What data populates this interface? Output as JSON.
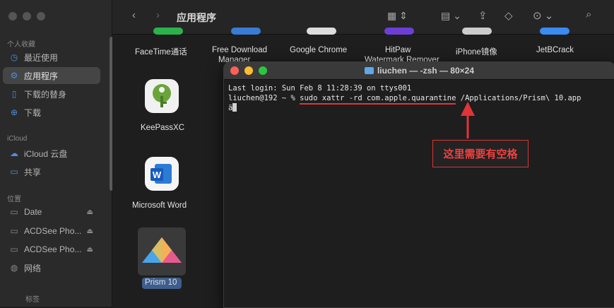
{
  "finder": {
    "title": "应用程序",
    "sidebar": {
      "sections": [
        {
          "label": "个人收藏"
        },
        {
          "label": "iCloud"
        },
        {
          "label": "位置"
        }
      ],
      "items": [
        {
          "label": "最近使用"
        },
        {
          "label": "应用程序"
        },
        {
          "label": "下载的替身"
        },
        {
          "label": "下载"
        },
        {
          "label": "iCloud 云盘"
        },
        {
          "label": "共享"
        },
        {
          "label": "Date"
        },
        {
          "label": "ACDSee Pho..."
        },
        {
          "label": "ACDSee Pho..."
        },
        {
          "label": "网络"
        },
        {
          "label": "标签"
        }
      ]
    },
    "apps": {
      "top_row": [
        "FaceTime通话",
        "Free Download",
        "Google Chrome",
        "HitPaw",
        "iPhone镜像",
        "JetBCrack"
      ],
      "top_row_partial": [
        "Manager",
        "Watermark Remover"
      ],
      "keepass": "KeePassXC",
      "word": "Microsoft Word",
      "prism": "Prism 10"
    }
  },
  "terminal": {
    "title": "liuchen — -zsh — 80×24",
    "line1": "Last login: Sun Feb  8 11:28:39 on ttys001",
    "prompt": "liuchen@192 ~ % ",
    "command": "sudo xattr -rd com.apple.quarantine",
    "args": " /Applications/Prism\\ 10.app",
    "line3": "ä"
  },
  "annotation": {
    "text": "这里需要有空格",
    "color": "#e0343a"
  }
}
